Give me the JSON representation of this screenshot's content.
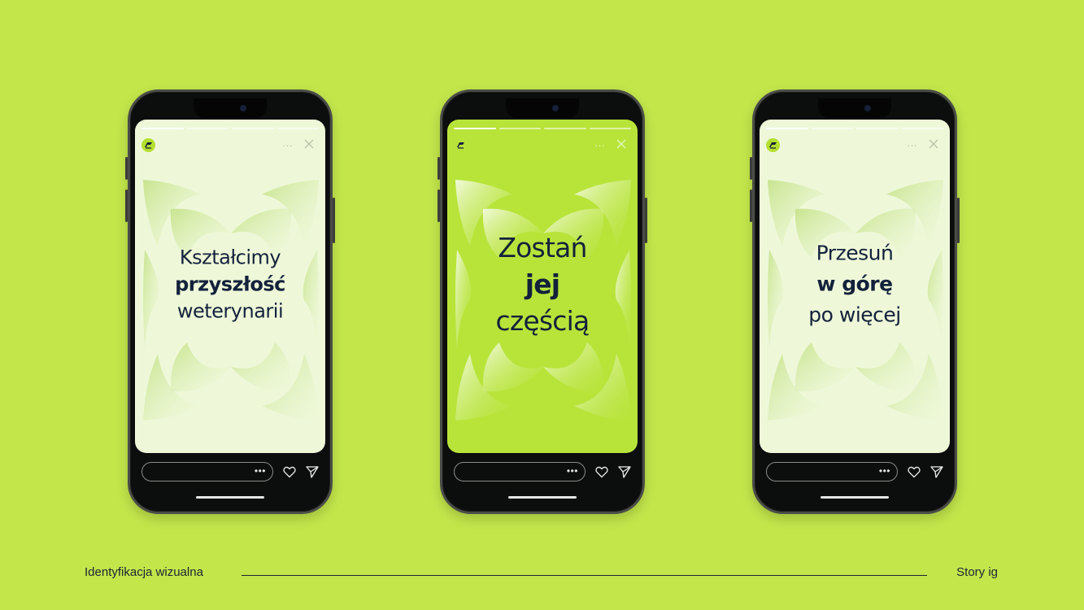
{
  "colors": {
    "background": "#c3e64b",
    "screen_light": "#eef8d9",
    "screen_lime": "#b8e43a",
    "text_navy": "#13213b"
  },
  "stories": [
    {
      "line1": "Kształcimy",
      "line2": "przyszłość",
      "line3": "weterynarii",
      "theme": "light",
      "bold_line": 2
    },
    {
      "line1": "Zostań",
      "line2": "jej",
      "line3": "częścią",
      "theme": "lime",
      "bold_line": 2
    },
    {
      "line1": "Przesuń",
      "line2": "w górę",
      "line3": "po więcej",
      "theme": "light",
      "bold_line": 2
    }
  ],
  "story_ui": {
    "more_icon": "more-icon",
    "close_icon": "close-icon",
    "reply_more": "•••",
    "like_icon": "heart-icon",
    "send_icon": "send-icon"
  },
  "footer": {
    "left": "Identyfikacja wizualna",
    "right": "Story ig"
  }
}
